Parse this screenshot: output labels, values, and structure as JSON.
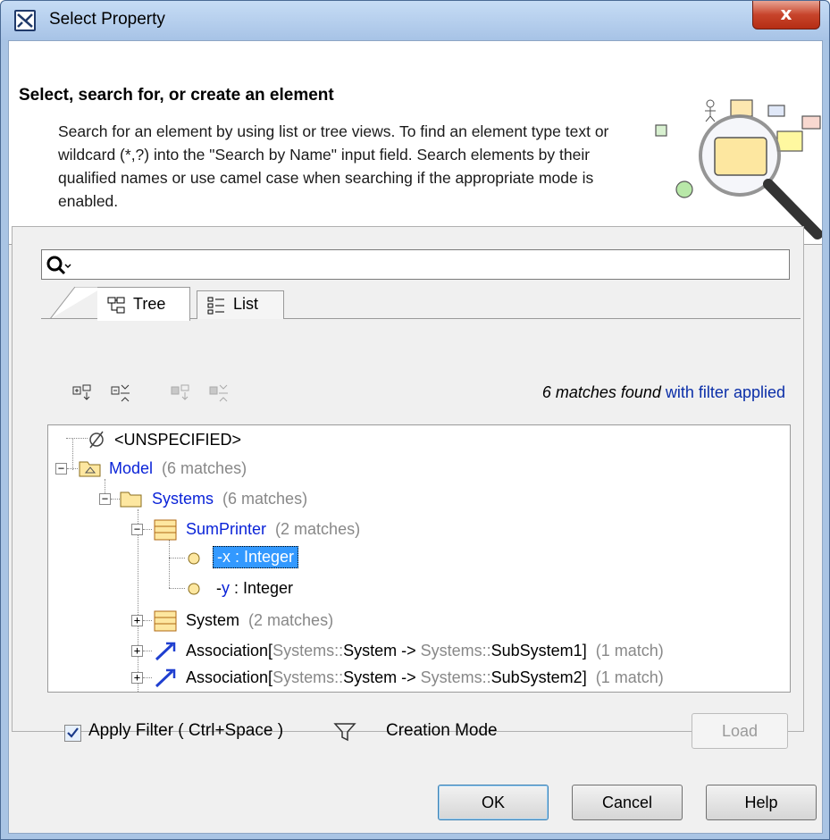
{
  "window": {
    "title": "Select Property",
    "close_label": "x"
  },
  "header": {
    "title": "Select, search for, or create an element",
    "description": "Search for an element by using list or tree views. To find an element type text or wildcard (*,?) into the \"Search by Name\" input field. Search elements by their qualified names or use camel case when searching if the appropriate mode is enabled."
  },
  "search": {
    "value": "",
    "placeholder": ""
  },
  "tabs": [
    {
      "label": "Tree",
      "icon": "tree-view-icon",
      "active": true
    },
    {
      "label": "List",
      "icon": "list-view-icon",
      "active": false
    }
  ],
  "toolbar": {
    "icons": [
      "expand-all-icon",
      "collapse-all-icon",
      "expand-selected-icon",
      "collapse-selected-icon"
    ],
    "matches_found": "6 matches found",
    "filter_applied": "with filter applied"
  },
  "tree": {
    "unspecified": "<UNSPECIFIED>",
    "model": {
      "name": "Model",
      "count": "(6 matches)"
    },
    "systems": {
      "name": "Systems",
      "count": "(6 matches)"
    },
    "sumprinter": {
      "name": "SumPrinter",
      "count": "(2 matches)"
    },
    "prop_x": {
      "name": "-x : Integer"
    },
    "prop_y": {
      "prefix": "-",
      "name": "y",
      "type": " : Integer"
    },
    "system": {
      "name": "System",
      "count": "(2 matches)"
    },
    "assoc1": {
      "prefix": "Association[",
      "src": "Systems::",
      "src_name": "System",
      "arrow": " -> ",
      "dst": "Systems::",
      "dst_name": "SubSystem1",
      "suffix": "]",
      "count": "(1 match)"
    },
    "assoc2": {
      "prefix": "Association[",
      "src": "Systems::",
      "src_name": "System",
      "arrow": " -> ",
      "dst": "Systems::",
      "dst_name": "SubSystem2",
      "suffix": "]",
      "count": "(1 match)"
    }
  },
  "options": {
    "apply_filter": "Apply Filter ( Ctrl+Space )",
    "apply_filter_checked": true,
    "creation_mode": "Creation Mode"
  },
  "buttons": {
    "load": "Load",
    "ok": "OK",
    "cancel": "Cancel",
    "help": "Help"
  },
  "colors": {
    "link_blue": "#0a23d8",
    "selection": "#3399ff",
    "count_gray": "#888888"
  }
}
